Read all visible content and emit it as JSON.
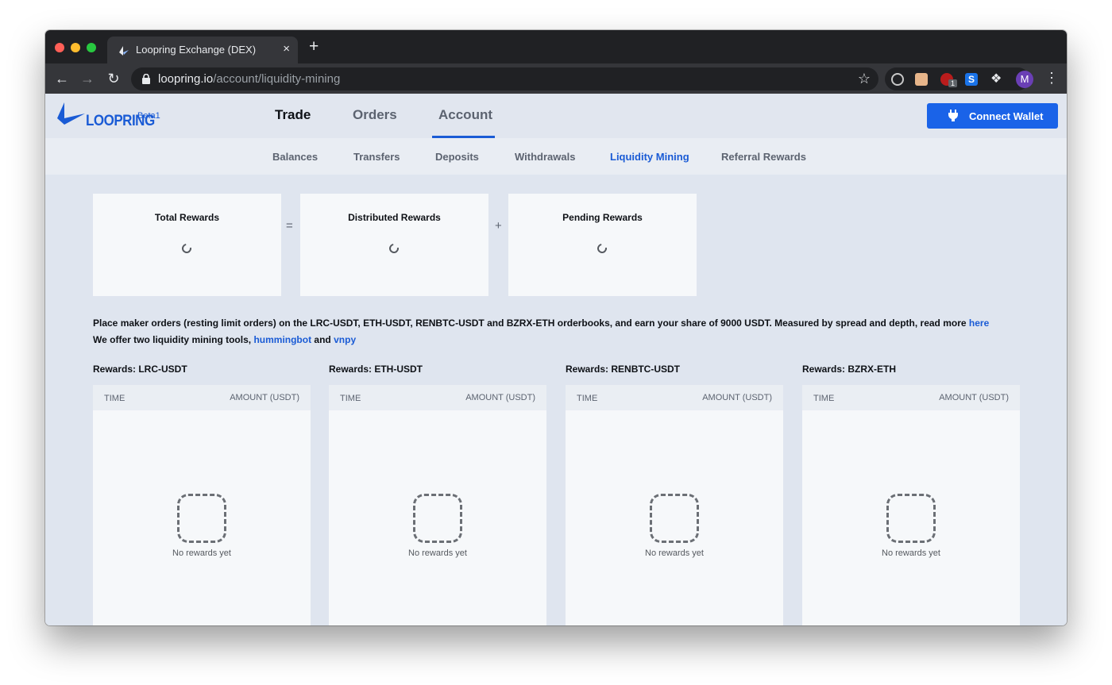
{
  "browser": {
    "tab_title": "Loopring Exchange (DEX)",
    "tab_close": "×",
    "new_tab": "+",
    "url_host": "loopring.io",
    "url_path": "/account/liquidity-mining",
    "extension_badge": "1",
    "extension_s_label": "S",
    "profile_initial": "M",
    "icons": [
      "back-icon",
      "forward-icon",
      "reload-icon",
      "lock-icon",
      "star-icon",
      "extension-icons",
      "puzzle-icon",
      "menu-dots-icon"
    ]
  },
  "header": {
    "logo_text": "LOOPRING",
    "beta_label": "Beta1",
    "nav": [
      {
        "label": "Trade"
      },
      {
        "label": "Orders"
      },
      {
        "label": "Account"
      }
    ],
    "connect_wallet_label": "Connect Wallet",
    "accent_color": "#1a5bd5"
  },
  "subnav": {
    "items": [
      {
        "label": "Balances"
      },
      {
        "label": "Transfers"
      },
      {
        "label": "Deposits"
      },
      {
        "label": "Withdrawals"
      },
      {
        "label": "Liquidity Mining"
      },
      {
        "label": "Referral Rewards"
      }
    ],
    "active": "Liquidity Mining"
  },
  "summary": {
    "cards": [
      {
        "title": "Total Rewards"
      },
      {
        "title": "Distributed Rewards"
      },
      {
        "title": "Pending Rewards"
      }
    ],
    "operators": [
      "=",
      "+"
    ]
  },
  "description": {
    "line1_text": "Place maker orders (resting limit orders) on the LRC-USDT, ETH-USDT, RENBTC-USDT and BZRX-ETH orderbooks, and earn your share of 9000 USDT. Measured by spread and depth, read more ",
    "line1_link": "here",
    "line2_text": "We offer two liquidity mining tools, ",
    "line2_link1": "hummingbot",
    "line2_mid": " and ",
    "line2_link2": "vnpy"
  },
  "rewards": [
    {
      "heading": "Rewards: LRC-USDT",
      "col_time": "TIME",
      "col_amount": "AMOUNT (USDT)",
      "empty": "No rewards yet"
    },
    {
      "heading": "Rewards: ETH-USDT",
      "col_time": "TIME",
      "col_amount": "AMOUNT (USDT)",
      "empty": "No rewards yet"
    },
    {
      "heading": "Rewards: RENBTC-USDT",
      "col_time": "TIME",
      "col_amount": "AMOUNT (USDT)",
      "empty": "No rewards yet"
    },
    {
      "heading": "Rewards: BZRX-ETH",
      "col_time": "TIME",
      "col_amount": "AMOUNT (USDT)",
      "empty": "No rewards yet"
    }
  ]
}
